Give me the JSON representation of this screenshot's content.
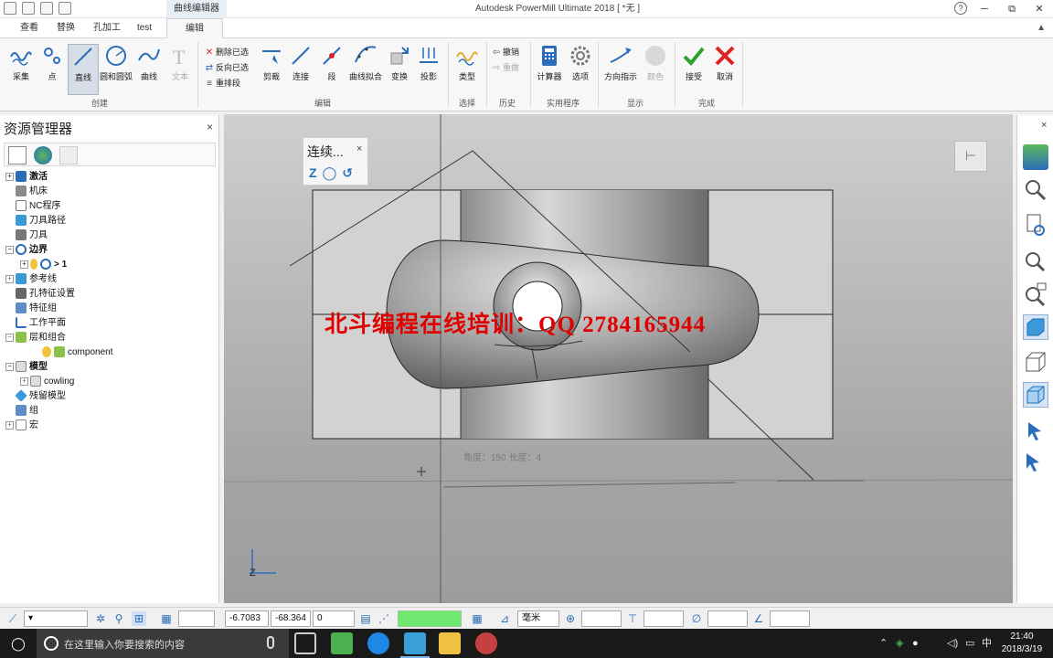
{
  "window": {
    "title": "Autodesk PowerMill Ultimate 2018   [ *无 ]",
    "context_tab": "曲线编辑器",
    "min": "─",
    "restore": "⧉",
    "close": "✕",
    "help": "?"
  },
  "tabs": [
    "查看",
    "替换",
    "孔加工",
    "test",
    "编辑"
  ],
  "ribbon": {
    "create": {
      "label": "创建",
      "buttons": [
        "采集",
        "点",
        "直线",
        "圆和圆弧",
        "曲线",
        "文本"
      ]
    },
    "edit": {
      "label": "编辑",
      "small": [
        "删除已选",
        "反向已选",
        "重排段"
      ],
      "buttons": [
        "剪裁",
        "连接",
        "段",
        "曲线拟合",
        "变换",
        "投影"
      ]
    },
    "select": {
      "label": "选择",
      "buttons": [
        "类型"
      ]
    },
    "history": {
      "label": "历史",
      "small": [
        "撤销",
        "重做"
      ]
    },
    "utility": {
      "label": "实用程序",
      "buttons": [
        "计算器",
        "选项"
      ]
    },
    "display": {
      "label": "显示",
      "buttons": [
        "方向指示",
        "颜色"
      ]
    },
    "finish": {
      "label": "完成",
      "buttons": [
        "接受",
        "取消"
      ]
    }
  },
  "explorer": {
    "title": "资源管理器",
    "close": "×",
    "tree": [
      {
        "label": "激活",
        "bold": true
      },
      {
        "label": "机床"
      },
      {
        "label": "NC程序"
      },
      {
        "label": "刀具路径"
      },
      {
        "label": "刀具"
      },
      {
        "label": "边界",
        "bold": true
      },
      {
        "label": "> 1",
        "bold": true
      },
      {
        "label": "参考线"
      },
      {
        "label": "孔特征设置"
      },
      {
        "label": "特征组"
      },
      {
        "label": "工作平面"
      },
      {
        "label": "层和组合"
      },
      {
        "label": "component"
      },
      {
        "label": "模型"
      },
      {
        "label": "cowling"
      },
      {
        "label": "残留模型"
      },
      {
        "label": "组"
      },
      {
        "label": "宏"
      }
    ]
  },
  "viewport": {
    "watermark": "北斗编程在线培训：QQ 2784165944",
    "status_text": "角度：150  长度：4",
    "popup_title": "连续...",
    "popup_close": "×",
    "popup_icons": [
      "Z",
      "◯",
      "↺"
    ],
    "axis_label": "Z",
    "pin_icon": "pin-icon"
  },
  "statusbar": {
    "x": "-6.7083",
    "y": "-68.364",
    "z": "0",
    "units": "毫米",
    "green_indicator_color": "#6fe86f"
  },
  "taskbar": {
    "search_placeholder": "在这里输入你要搜索的内容",
    "ime": "中",
    "time": "21:40",
    "date": "2018/3/19"
  }
}
